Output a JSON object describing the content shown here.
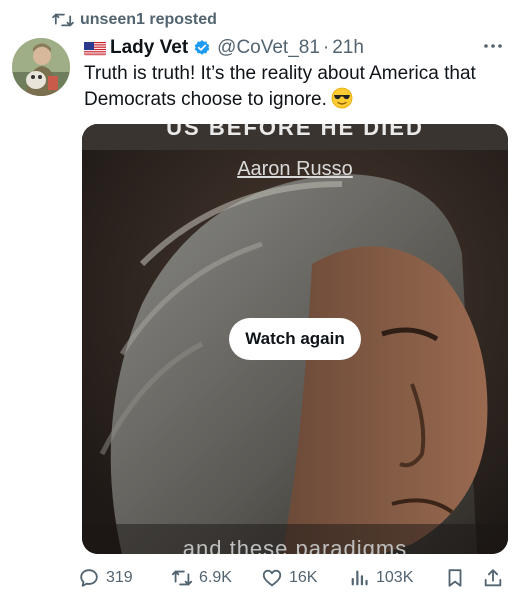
{
  "repost": {
    "label": "unseen1 reposted"
  },
  "author": {
    "display_name": "Lady Vet",
    "handle": "@CoVet_81",
    "separator": "·",
    "time": "21h"
  },
  "tweet": {
    "text": "Truth is truth! It’s the reality about America that Democrats choose to ignore."
  },
  "media": {
    "top_caption": "US BEFORE HE DIED",
    "name_caption": "Aaron Russo",
    "bottom_caption": "and these paradigms",
    "watch_again_label": "Watch again"
  },
  "actions": {
    "replies": "319",
    "reposts": "6.9K",
    "likes": "16K",
    "views": "103K"
  },
  "colors": {
    "secondary_text": "#536471",
    "verified_blue": "#1d9bf0",
    "repost_green": "#536471"
  }
}
